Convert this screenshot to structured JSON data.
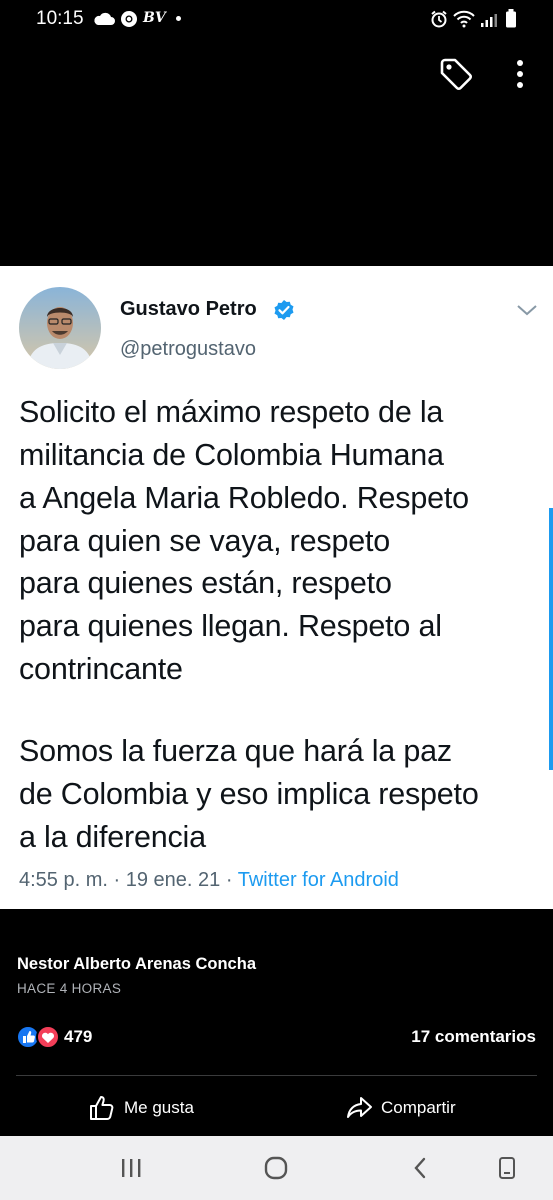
{
  "status_bar": {
    "time": "10:15",
    "icons": [
      "cloud-icon",
      "chrome-icon",
      "bv-icon",
      "dot-icon",
      "alarm-icon",
      "wifi-icon",
      "signal-icon",
      "battery-icon"
    ],
    "bv_text": "BV"
  },
  "top_actions": {
    "icons": [
      "tag-icon",
      "more-vertical-icon"
    ]
  },
  "tweet": {
    "author_name": "Gustavo Petro",
    "handle": "@petrogustavo",
    "lines": [
      "Solicito el máximo respeto de la",
      "militancia de Colombia Humana",
      "a Angela Maria Robledo. Respeto",
      "para quien se vaya, respeto",
      "para quienes están, respeto",
      "para quienes llegan. Respeto al",
      "contrincante",
      "Somos la fuerza que hará la paz",
      "de Colombia y eso implica respeto",
      "a la diferencia"
    ],
    "time": "4:55 p. m.",
    "separator": "·",
    "date": "19 ene. 21",
    "source": "Twitter for Android",
    "colors": {
      "verified": "#1d9bf0",
      "link": "#1d9bf0",
      "secondary_text": "#536471"
    }
  },
  "post": {
    "poster_name": "Nestor Alberto Arenas Concha",
    "time_ago": "HACE 4 HORAS",
    "reaction_count": "479",
    "comments": "17 comentarios",
    "like_label": "Me gusta",
    "share_label": "Compartir",
    "colors": {
      "like": "#1877f2",
      "love": "#f33e58"
    }
  },
  "nav_bar": {
    "icons": [
      "recent-apps-icon",
      "home-icon",
      "back-icon",
      "rotate-icon"
    ]
  }
}
